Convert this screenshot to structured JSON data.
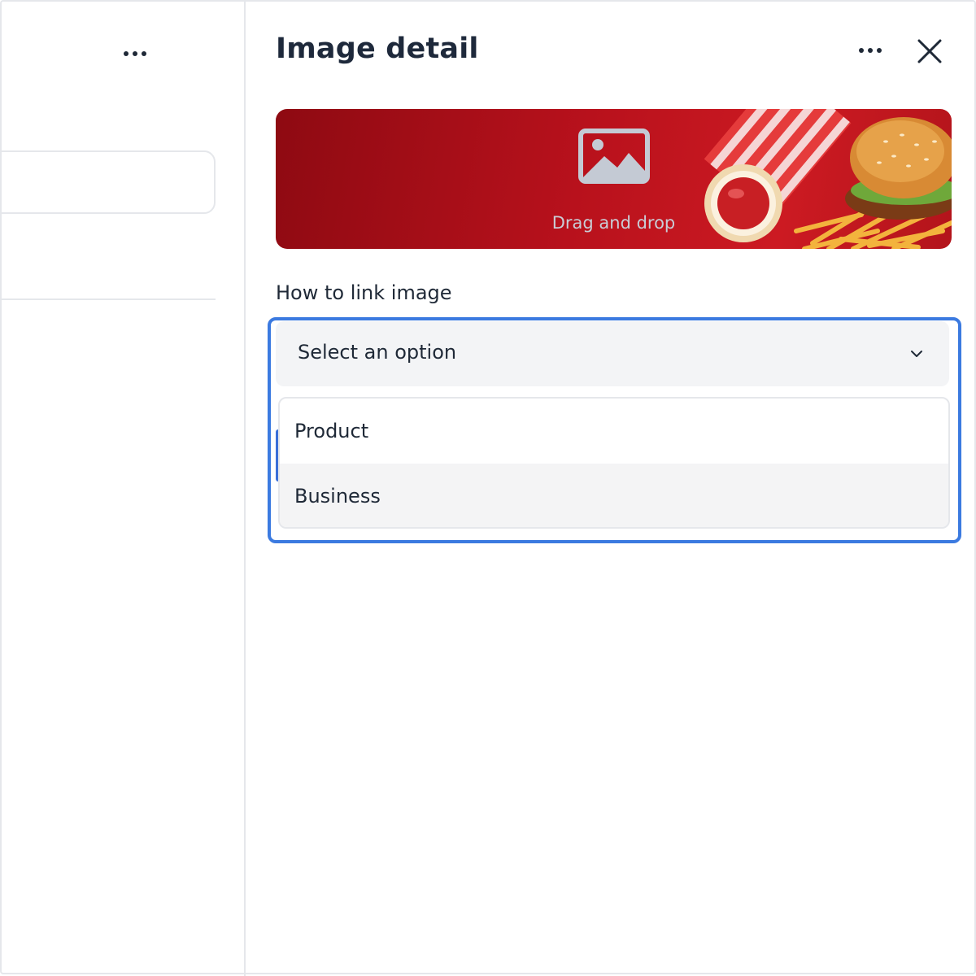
{
  "left_panel": {
    "more_icon": "more-horizontal-icon"
  },
  "panel": {
    "title": "Image detail",
    "more_icon": "more-horizontal-icon",
    "close_icon": "close-icon"
  },
  "upload": {
    "drag_text": "Drag and drop",
    "icon": "image-icon"
  },
  "link_field": {
    "label": "How to link image",
    "placeholder": "Select an option",
    "chevron_icon": "chevron-down-icon",
    "options": [
      "Product",
      "Business"
    ],
    "highlighted_option": "Business"
  },
  "colors": {
    "focus_ring": "#3b7ae0",
    "banner_red": "#b8111c",
    "select_bg": "#f3f4f6"
  }
}
